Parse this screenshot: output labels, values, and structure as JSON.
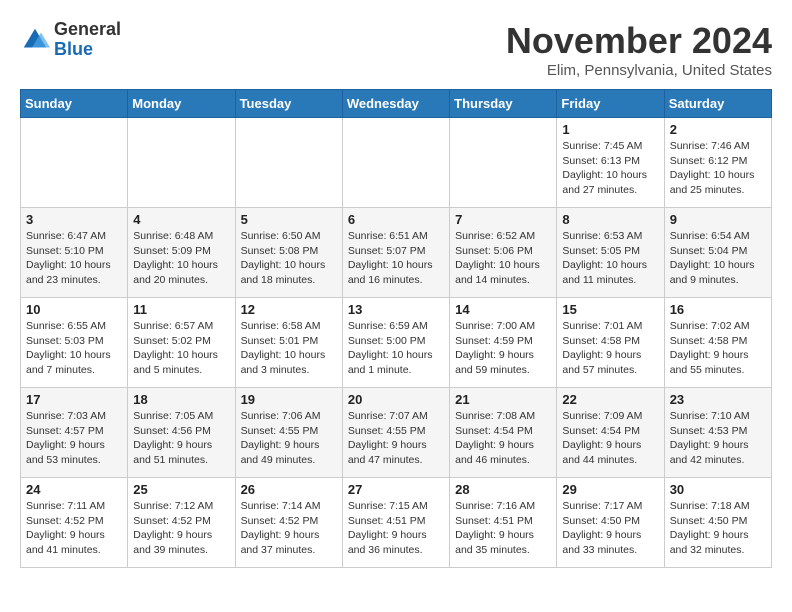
{
  "logo": {
    "general": "General",
    "blue": "Blue"
  },
  "title": "November 2024",
  "location": "Elim, Pennsylvania, United States",
  "weekdays": [
    "Sunday",
    "Monday",
    "Tuesday",
    "Wednesday",
    "Thursday",
    "Friday",
    "Saturday"
  ],
  "weeks": [
    [
      {
        "day": "",
        "info": ""
      },
      {
        "day": "",
        "info": ""
      },
      {
        "day": "",
        "info": ""
      },
      {
        "day": "",
        "info": ""
      },
      {
        "day": "",
        "info": ""
      },
      {
        "day": "1",
        "info": "Sunrise: 7:45 AM\nSunset: 6:13 PM\nDaylight: 10 hours and 27 minutes."
      },
      {
        "day": "2",
        "info": "Sunrise: 7:46 AM\nSunset: 6:12 PM\nDaylight: 10 hours and 25 minutes."
      }
    ],
    [
      {
        "day": "3",
        "info": "Sunrise: 6:47 AM\nSunset: 5:10 PM\nDaylight: 10 hours and 23 minutes."
      },
      {
        "day": "4",
        "info": "Sunrise: 6:48 AM\nSunset: 5:09 PM\nDaylight: 10 hours and 20 minutes."
      },
      {
        "day": "5",
        "info": "Sunrise: 6:50 AM\nSunset: 5:08 PM\nDaylight: 10 hours and 18 minutes."
      },
      {
        "day": "6",
        "info": "Sunrise: 6:51 AM\nSunset: 5:07 PM\nDaylight: 10 hours and 16 minutes."
      },
      {
        "day": "7",
        "info": "Sunrise: 6:52 AM\nSunset: 5:06 PM\nDaylight: 10 hours and 14 minutes."
      },
      {
        "day": "8",
        "info": "Sunrise: 6:53 AM\nSunset: 5:05 PM\nDaylight: 10 hours and 11 minutes."
      },
      {
        "day": "9",
        "info": "Sunrise: 6:54 AM\nSunset: 5:04 PM\nDaylight: 10 hours and 9 minutes."
      }
    ],
    [
      {
        "day": "10",
        "info": "Sunrise: 6:55 AM\nSunset: 5:03 PM\nDaylight: 10 hours and 7 minutes."
      },
      {
        "day": "11",
        "info": "Sunrise: 6:57 AM\nSunset: 5:02 PM\nDaylight: 10 hours and 5 minutes."
      },
      {
        "day": "12",
        "info": "Sunrise: 6:58 AM\nSunset: 5:01 PM\nDaylight: 10 hours and 3 minutes."
      },
      {
        "day": "13",
        "info": "Sunrise: 6:59 AM\nSunset: 5:00 PM\nDaylight: 10 hours and 1 minute."
      },
      {
        "day": "14",
        "info": "Sunrise: 7:00 AM\nSunset: 4:59 PM\nDaylight: 9 hours and 59 minutes."
      },
      {
        "day": "15",
        "info": "Sunrise: 7:01 AM\nSunset: 4:58 PM\nDaylight: 9 hours and 57 minutes."
      },
      {
        "day": "16",
        "info": "Sunrise: 7:02 AM\nSunset: 4:58 PM\nDaylight: 9 hours and 55 minutes."
      }
    ],
    [
      {
        "day": "17",
        "info": "Sunrise: 7:03 AM\nSunset: 4:57 PM\nDaylight: 9 hours and 53 minutes."
      },
      {
        "day": "18",
        "info": "Sunrise: 7:05 AM\nSunset: 4:56 PM\nDaylight: 9 hours and 51 minutes."
      },
      {
        "day": "19",
        "info": "Sunrise: 7:06 AM\nSunset: 4:55 PM\nDaylight: 9 hours and 49 minutes."
      },
      {
        "day": "20",
        "info": "Sunrise: 7:07 AM\nSunset: 4:55 PM\nDaylight: 9 hours and 47 minutes."
      },
      {
        "day": "21",
        "info": "Sunrise: 7:08 AM\nSunset: 4:54 PM\nDaylight: 9 hours and 46 minutes."
      },
      {
        "day": "22",
        "info": "Sunrise: 7:09 AM\nSunset: 4:54 PM\nDaylight: 9 hours and 44 minutes."
      },
      {
        "day": "23",
        "info": "Sunrise: 7:10 AM\nSunset: 4:53 PM\nDaylight: 9 hours and 42 minutes."
      }
    ],
    [
      {
        "day": "24",
        "info": "Sunrise: 7:11 AM\nSunset: 4:52 PM\nDaylight: 9 hours and 41 minutes."
      },
      {
        "day": "25",
        "info": "Sunrise: 7:12 AM\nSunset: 4:52 PM\nDaylight: 9 hours and 39 minutes."
      },
      {
        "day": "26",
        "info": "Sunrise: 7:14 AM\nSunset: 4:52 PM\nDaylight: 9 hours and 37 minutes."
      },
      {
        "day": "27",
        "info": "Sunrise: 7:15 AM\nSunset: 4:51 PM\nDaylight: 9 hours and 36 minutes."
      },
      {
        "day": "28",
        "info": "Sunrise: 7:16 AM\nSunset: 4:51 PM\nDaylight: 9 hours and 35 minutes."
      },
      {
        "day": "29",
        "info": "Sunrise: 7:17 AM\nSunset: 4:50 PM\nDaylight: 9 hours and 33 minutes."
      },
      {
        "day": "30",
        "info": "Sunrise: 7:18 AM\nSunset: 4:50 PM\nDaylight: 9 hours and 32 minutes."
      }
    ]
  ]
}
